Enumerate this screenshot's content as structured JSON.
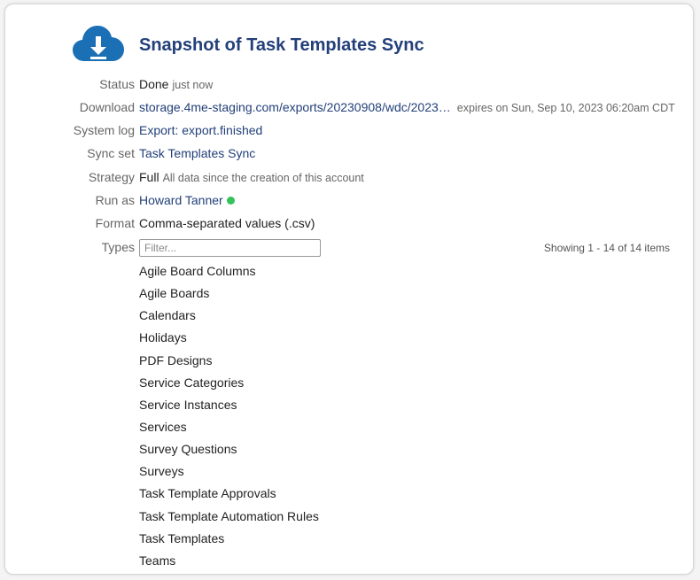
{
  "page": {
    "title": "Snapshot of Task Templates Sync",
    "icon": "cloud-download-icon",
    "accent_color": "#23407a",
    "icon_color": "#1a6fb5",
    "online_color": "#34c25b"
  },
  "details": {
    "status": {
      "label": "Status",
      "value": "Done",
      "note": "just now"
    },
    "download": {
      "label": "Download",
      "link": "storage.4me-staging.com/exports/20230908/wdc/2023…",
      "note": "expires on Sun, Sep 10, 2023 06:20am CDT"
    },
    "system_log": {
      "label": "System log",
      "link": "Export: export.finished"
    },
    "sync_set": {
      "label": "Sync set",
      "link": "Task Templates Sync"
    },
    "strategy": {
      "label": "Strategy",
      "value": "Full",
      "note": "All data since the creation of this account"
    },
    "run_as": {
      "label": "Run as",
      "link": "Howard Tanner"
    },
    "format": {
      "label": "Format",
      "value": "Comma-separated values (.csv)"
    }
  },
  "types": {
    "label": "Types",
    "filter_placeholder": "Filter...",
    "showing": "Showing 1 - 14 of 14 items",
    "items": [
      "Agile Board Columns",
      "Agile Boards",
      "Calendars",
      "Holidays",
      "PDF Designs",
      "Service Categories",
      "Service Instances",
      "Services",
      "Survey Questions",
      "Surveys",
      "Task Template Approvals",
      "Task Template Automation Rules",
      "Task Templates",
      "Teams"
    ]
  }
}
